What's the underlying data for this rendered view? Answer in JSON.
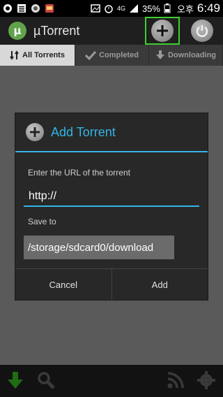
{
  "statusbar": {
    "battery": "35%",
    "ampm": "오후",
    "time": "6:49",
    "network": "4G"
  },
  "actionbar": {
    "app_title": "µTorrent",
    "add_icon": "plus-icon",
    "power_icon": "power-icon"
  },
  "tabs": [
    {
      "label": "All Torrents",
      "icon": "sort-icon",
      "active": true
    },
    {
      "label": "Completed",
      "icon": "check-icon",
      "active": false
    },
    {
      "label": "Downloading",
      "icon": "download-arrow-icon",
      "active": false
    }
  ],
  "dialog": {
    "title": "Add Torrent",
    "url_label": "Enter the URL of the torrent",
    "url_value": "http://",
    "save_label": "Save to",
    "save_path": "/storage/sdcard0/download",
    "cancel": "Cancel",
    "add": "Add"
  },
  "bottombar": {
    "icons": [
      "download-icon",
      "search-icon",
      "rss-icon",
      "settings-icon"
    ]
  },
  "colors": {
    "accent": "#33b5e5",
    "highlight": "#3fcf2f",
    "logo": "#61a34a"
  }
}
